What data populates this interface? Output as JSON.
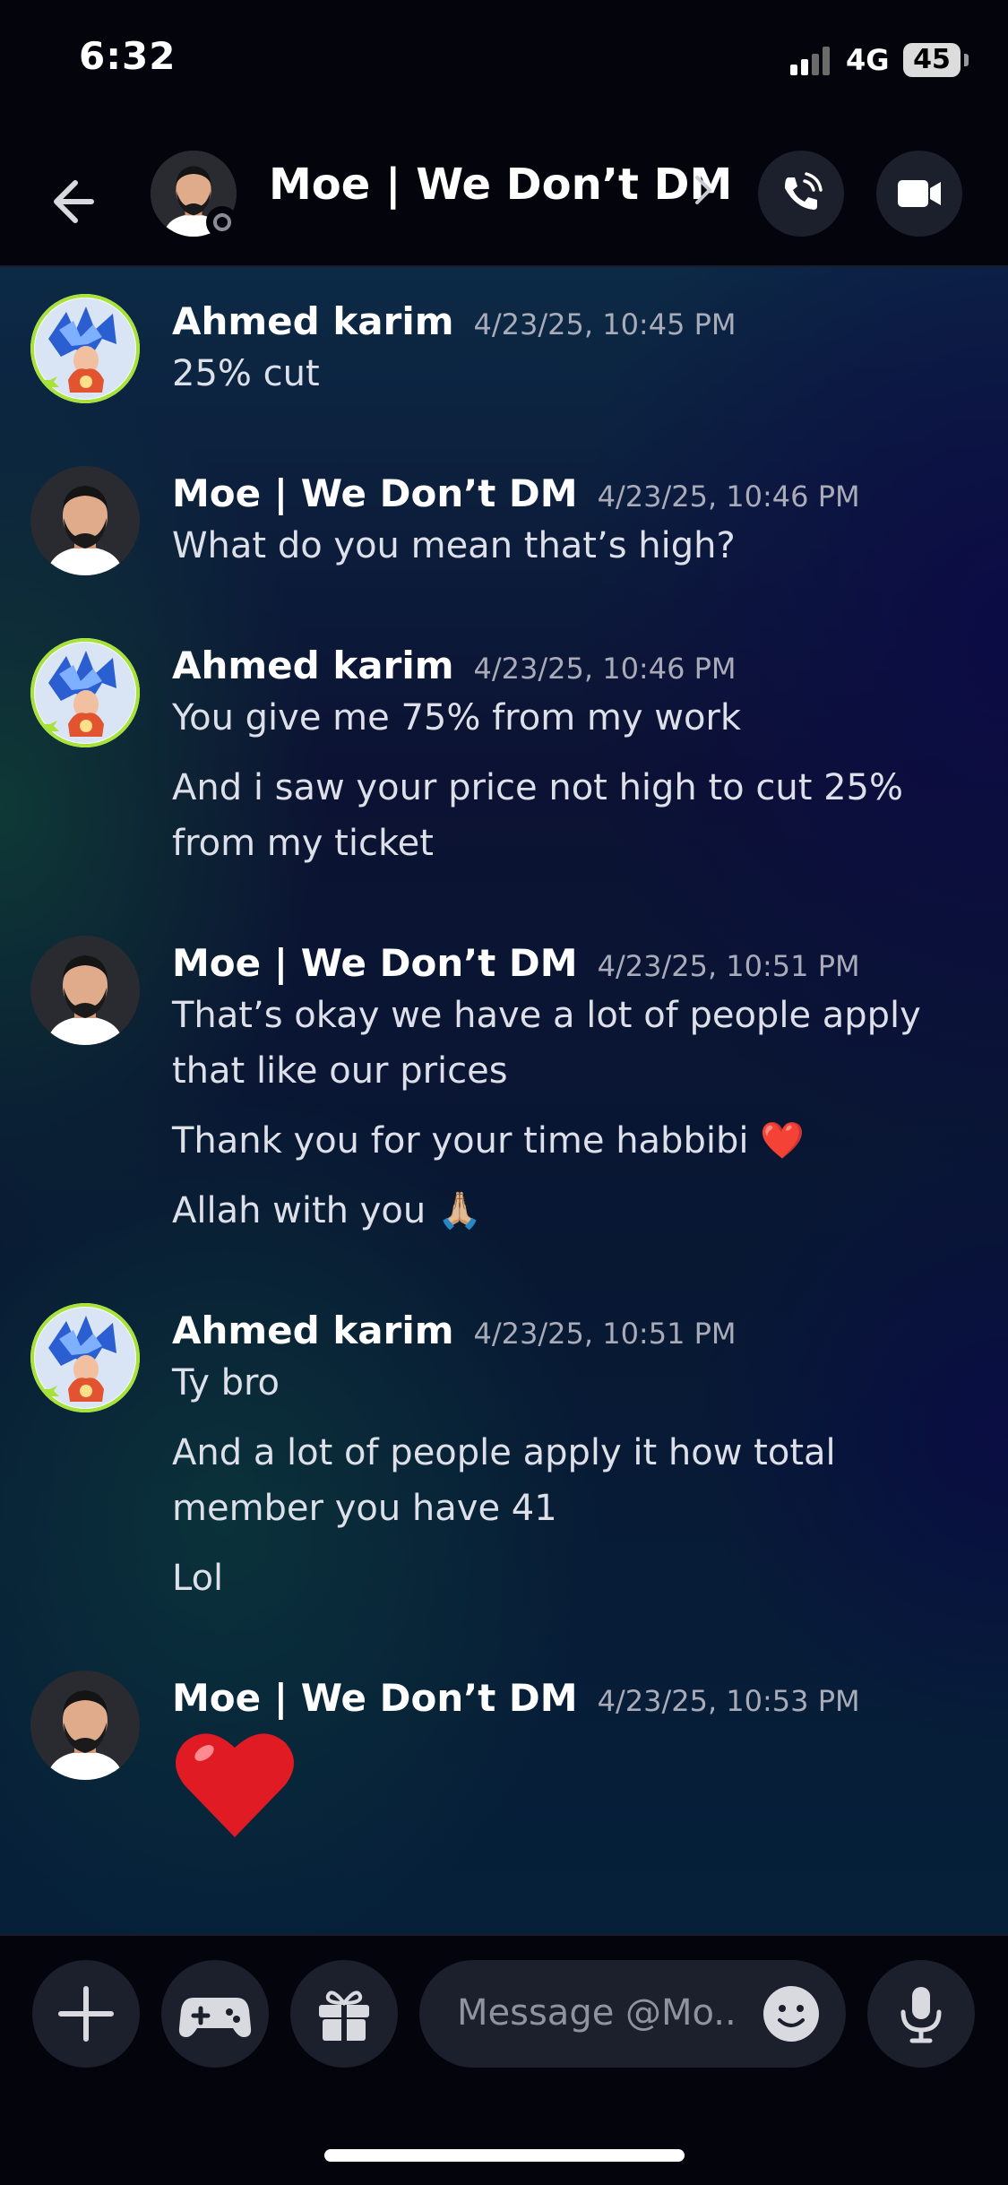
{
  "status_bar": {
    "time": "6:32",
    "network": "4G",
    "battery": "45"
  },
  "header": {
    "title": "Moe | We Don’t DM"
  },
  "messages": [
    {
      "author": "Ahmed karim",
      "timestamp": "4/23/25, 10:45 PM",
      "lines": [
        "25% cut"
      ]
    },
    {
      "author": "Moe | We Don’t DM",
      "timestamp": "4/23/25, 10:46 PM",
      "lines": [
        "What do you mean that’s high?"
      ]
    },
    {
      "author": "Ahmed karim",
      "timestamp": "4/23/25, 10:46 PM",
      "lines": [
        "You give me 75% from my work",
        "And i saw your price not high to cut 25%",
        "from my ticket"
      ]
    },
    {
      "author": "Moe | We Don’t DM",
      "timestamp": "4/23/25, 10:51 PM",
      "lines": [
        "That’s okay we have a lot of people apply",
        "that like our prices",
        "Thank you for your time habbibi ❤️",
        "Allah with you 🙏🏼"
      ]
    },
    {
      "author": "Ahmed karim",
      "timestamp": "4/23/25, 10:51 PM",
      "lines": [
        "Ty bro",
        "And a lot of people apply it how total",
        "member you have 41",
        "Lol"
      ]
    },
    {
      "author": "Moe | We Don’t DM",
      "timestamp": "4/23/25, 10:53 PM",
      "lines": [
        "❤️"
      ]
    }
  ],
  "composer": {
    "placeholder": "Message @Mo.."
  },
  "icons": {
    "back": "arrow-left-icon",
    "call": "phone-call-icon",
    "video": "video-camera-icon",
    "plus": "plus-icon",
    "games": "gamepad-icon",
    "gift": "gift-icon",
    "emoji": "smiley-icon",
    "mic": "microphone-icon"
  },
  "colors": {
    "accent_green": "#9be13a",
    "heart": "#e01b24",
    "bubble_bg": "#1c1f2c"
  }
}
